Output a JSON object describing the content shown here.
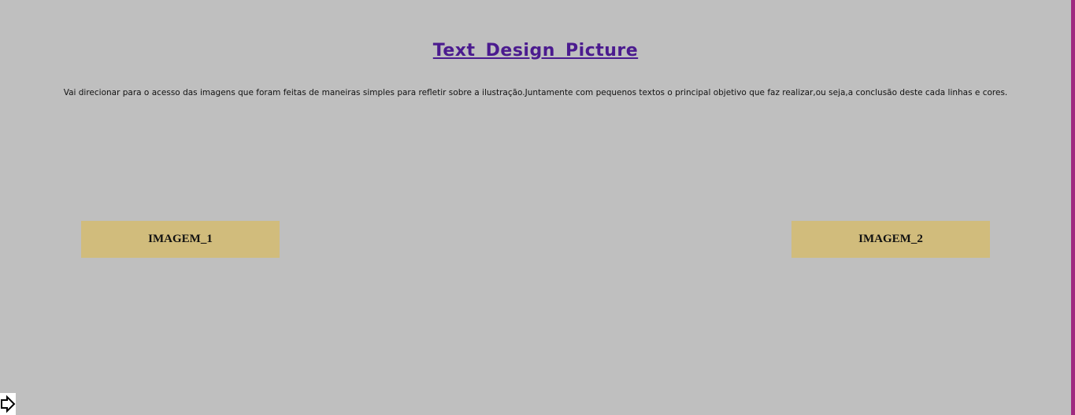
{
  "header": {
    "title": "Text Design Picture",
    "description": "Vai direcionar para o acesso das imagens que foram feitas de maneiras simples para refletir sobre a ilustração.Juntamente com pequenos textos o principal objetivo que faz realizar,ou seja,a conclusão deste cada linhas e cores."
  },
  "buttons": {
    "image_1_label": "IMAGEM_1",
    "image_2_label": "IMAGEM_2"
  },
  "colors": {
    "background": "#bfbfbf",
    "title": "#4b1b8f",
    "button": "#d1bc7c",
    "right_edge": "#a0287f"
  },
  "icons": {
    "corner": "arrow-right-icon"
  }
}
